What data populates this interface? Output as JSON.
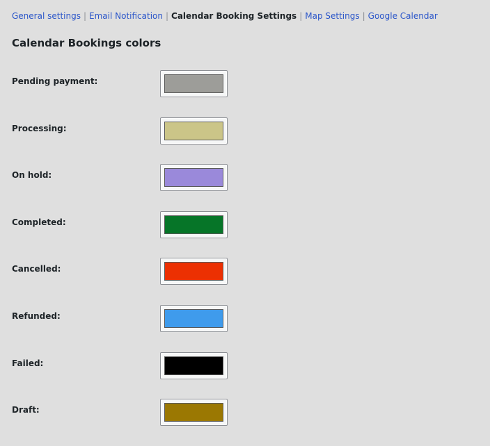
{
  "subnav": {
    "items": [
      {
        "label": "General settings"
      },
      {
        "label": "Email Notification"
      },
      {
        "label": "Calendar Booking Settings"
      },
      {
        "label": "Map Settings"
      },
      {
        "label": "Google Calendar"
      }
    ],
    "separator": "|"
  },
  "section_title": "Calendar Bookings colors",
  "colors": [
    {
      "label": "Pending payment:",
      "color": "#9d9d99"
    },
    {
      "label": "Processing:",
      "color": "#cbc588"
    },
    {
      "label": "On hold:",
      "color": "#9a89da"
    },
    {
      "label": "Completed:",
      "color": "#067528"
    },
    {
      "label": "Cancelled:",
      "color": "#ec3002"
    },
    {
      "label": "Refunded:",
      "color": "#3f9bec"
    },
    {
      "label": "Failed:",
      "color": "#000000"
    },
    {
      "label": "Draft:",
      "color": "#9b7802"
    }
  ]
}
